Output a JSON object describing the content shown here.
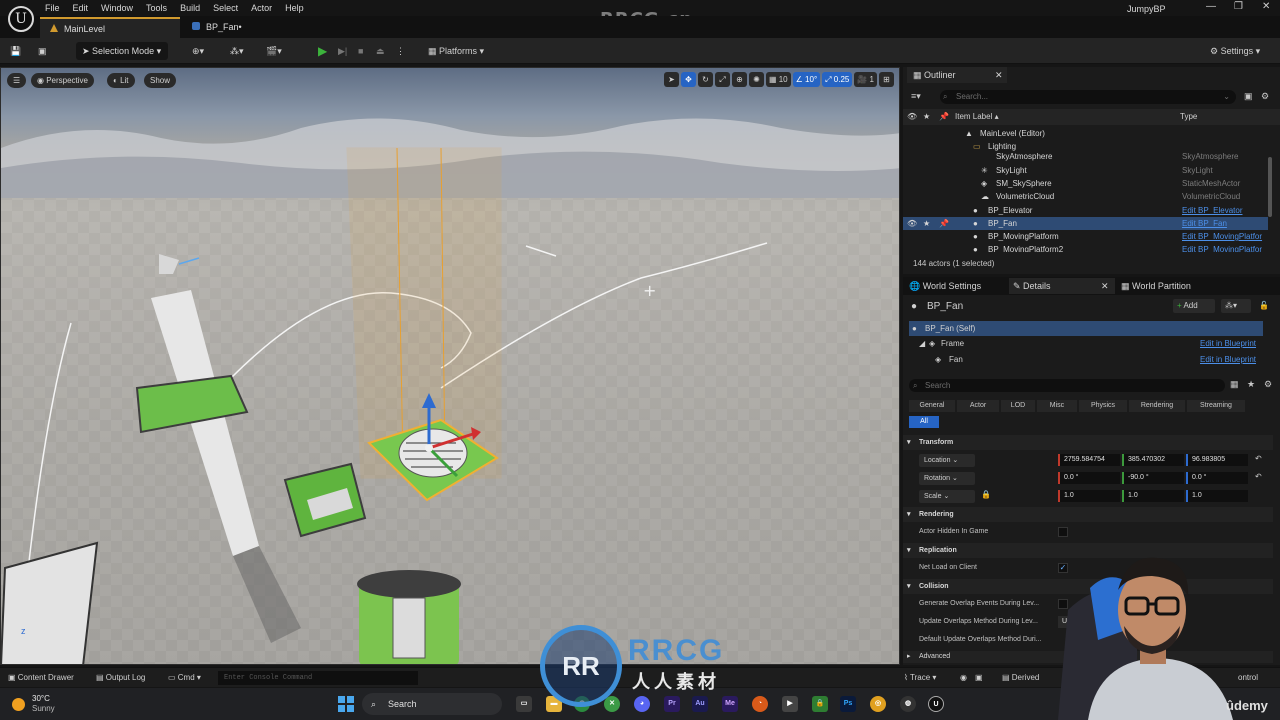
{
  "menu": [
    "File",
    "Edit",
    "Window",
    "Tools",
    "Build",
    "Select",
    "Actor",
    "Help"
  ],
  "watermark_top": "RRCG.cn",
  "project": "JumpyBP",
  "tabs": [
    {
      "label": "MainLevel"
    },
    {
      "label": "BP_Fan•"
    }
  ],
  "toolbar": {
    "selection_mode": "Selection Mode",
    "platforms": "Platforms",
    "settings": "Settings"
  },
  "viewport": {
    "perspective": "Perspective",
    "lit": "Lit",
    "show": "Show",
    "grid_snap": "10",
    "rotation_snap": "10°",
    "scale_snap": "0.25",
    "camera_speed": "1"
  },
  "outliner": {
    "tab": "Outliner",
    "search_placeholder": "Search...",
    "col_label": "Item Label ▴",
    "col_type": "Type",
    "rows": [
      {
        "label": "MainLevel (Editor)",
        "type": "",
        "link": false
      },
      {
        "label": "Lighting",
        "type": "",
        "link": false
      },
      {
        "label": "SkyAtmosphere",
        "type": "SkyAtmosphere",
        "link": false
      },
      {
        "label": "SkyLight",
        "type": "SkyLight",
        "link": false
      },
      {
        "label": "SM_SkySphere",
        "type": "StaticMeshActor",
        "link": false
      },
      {
        "label": "VolumetricCloud",
        "type": "VolumetricCloud",
        "link": false
      },
      {
        "label": "BP_Elevator",
        "type": "Edit BP_Elevator",
        "link": true
      },
      {
        "label": "BP_Fan",
        "type": "Edit BP_Fan",
        "link": true
      },
      {
        "label": "BP_MovingPlatform",
        "type": "Edit BP_MovingPlatfor",
        "link": true
      },
      {
        "label": "BP_MovingPlatform2",
        "type": "Edit BP_MovingPlatfor",
        "link": true
      }
    ],
    "footer": "144 actors (1 selected)"
  },
  "details": {
    "tabs": [
      "World Settings",
      "Details",
      "World Partition"
    ],
    "actor": "BP_Fan",
    "add": "Add",
    "components": [
      {
        "label": "BP_Fan (Self)",
        "link": ""
      },
      {
        "label": "Frame",
        "link": "Edit in Blueprint"
      },
      {
        "label": "Fan",
        "link": "Edit in Blueprint"
      }
    ],
    "search_placeholder": "Search",
    "filters": [
      "General",
      "Actor",
      "LOD",
      "Misc",
      "Physics",
      "Rendering",
      "Streaming",
      "All"
    ],
    "transform_label": "Transform",
    "location": {
      "label": "Location",
      "x": "2759.584754",
      "y": "385.470302",
      "z": "96.983805"
    },
    "rotation": {
      "label": "Rotation",
      "x": "0.0 °",
      "y": "-90.0 °",
      "z": "0.0 °"
    },
    "scale": {
      "label": "Scale",
      "x": "1.0",
      "y": "1.0",
      "z": "1.0"
    },
    "rendering_label": "Rendering",
    "actor_hidden": "Actor Hidden In Game",
    "replication_label": "Replication",
    "net_load": "Net Load on Client",
    "collision_label": "Collision",
    "gen_overlap": "Generate Overlap Events During Lev...",
    "update_overlap": "Update Overlaps Method During Lev...",
    "update_overlap_val": "Us",
    "default_overlap": "Default Update Overlaps Method Duri...",
    "advanced": "Advanced"
  },
  "statusbar": {
    "content_drawer": "Content Drawer",
    "output_log": "Output Log",
    "cmd": "Cmd",
    "console_placeholder": "Enter Console Command",
    "trace": "Trace",
    "derived": "Derived",
    "control": "ontrol"
  },
  "taskbar": {
    "temp": "30°C",
    "weather": "Sunny",
    "search": "Search"
  },
  "watermark": {
    "logo": "RR",
    "brand": "RRCG",
    "sub": "人人素材"
  },
  "udemy": "ûdemy"
}
